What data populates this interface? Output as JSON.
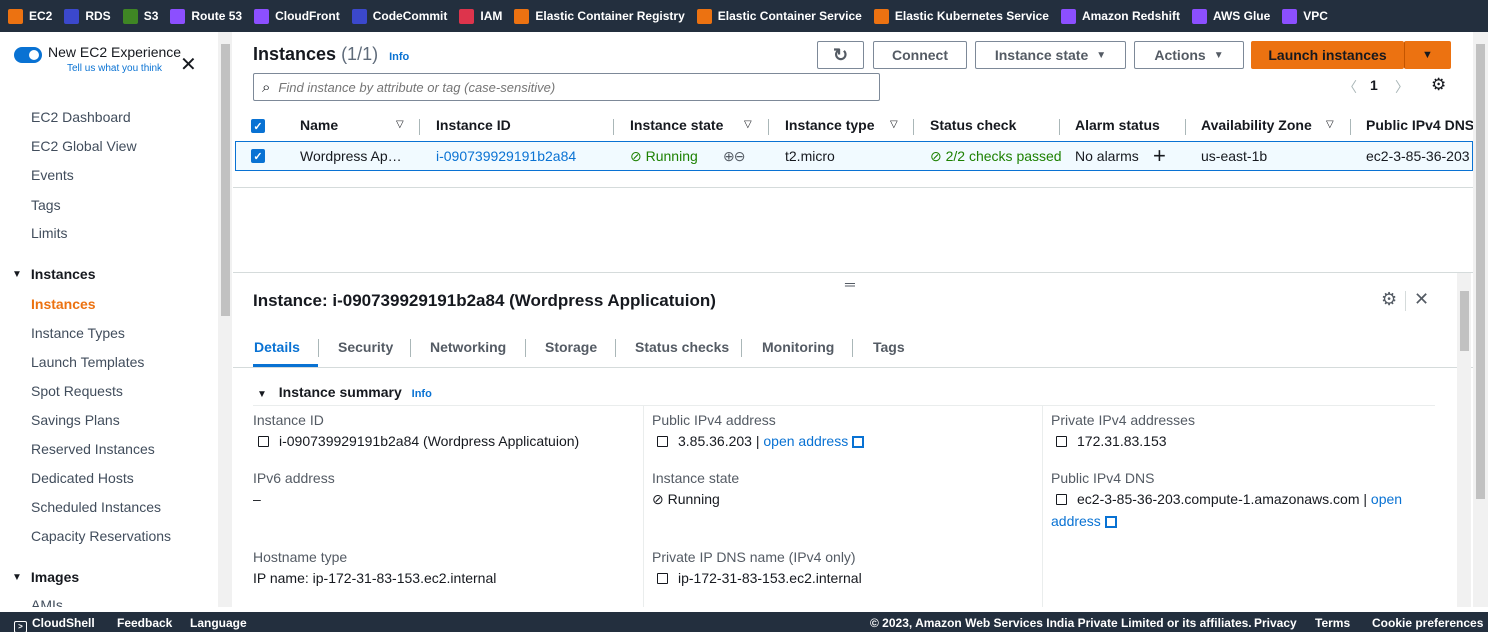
{
  "topbar": {
    "services": [
      {
        "label": "EC2",
        "color": "#ec7211"
      },
      {
        "label": "RDS",
        "color": "#3b48cc"
      },
      {
        "label": "S3",
        "color": "#3f8624"
      },
      {
        "label": "Route 53",
        "color": "#8c4fff"
      },
      {
        "label": "CloudFront",
        "color": "#8c4fff"
      },
      {
        "label": "CodeCommit",
        "color": "#3b48cc"
      },
      {
        "label": "IAM",
        "color": "#dd344c"
      },
      {
        "label": "Elastic Container Registry",
        "color": "#ec7211"
      },
      {
        "label": "Elastic Container Service",
        "color": "#ec7211"
      },
      {
        "label": "Elastic Kubernetes Service",
        "color": "#ec7211"
      },
      {
        "label": "Amazon Redshift",
        "color": "#8c4fff"
      },
      {
        "label": "AWS Glue",
        "color": "#8c4fff"
      },
      {
        "label": "VPC",
        "color": "#8c4fff"
      }
    ]
  },
  "sidebar": {
    "toggle_title": "New EC2 Experience",
    "toggle_link": "Tell us what you think",
    "items": [
      "EC2 Dashboard",
      "EC2 Global View",
      "Events",
      "Tags",
      "Limits"
    ],
    "section_instances": "Instances",
    "instances_items": [
      "Instances",
      "Instance Types",
      "Launch Templates",
      "Spot Requests",
      "Savings Plans",
      "Reserved Instances",
      "Dedicated Hosts",
      "Scheduled Instances",
      "Capacity Reservations"
    ],
    "section_images": "Images",
    "images_items": [
      "AMIs"
    ]
  },
  "header": {
    "title": "Instances",
    "count": "(1/1)",
    "info": "Info",
    "connect": "Connect",
    "instance_state": "Instance state",
    "actions": "Actions",
    "launch": "Launch instances"
  },
  "search": {
    "placeholder": "Find instance by attribute or tag (case-sensitive)"
  },
  "pager": {
    "page": "1"
  },
  "table": {
    "headers": [
      "Name",
      "Instance ID",
      "Instance state",
      "Instance type",
      "Status check",
      "Alarm status",
      "Availability Zone",
      "Public IPv4 DNS"
    ],
    "row": {
      "name": "Wordpress Ap…",
      "id": "i-090739929191b2a84",
      "state": "Running",
      "type": "t2.micro",
      "status": "2/2 checks passed",
      "alarm": "No alarms",
      "az": "us-east-1b",
      "dns": "ec2-3-85-36-203"
    }
  },
  "details": {
    "title": "Instance: i-090739929191b2a84 (Wordpress Applicatuion)",
    "tabs": [
      "Details",
      "Security",
      "Networking",
      "Storage",
      "Status checks",
      "Monitoring",
      "Tags"
    ],
    "summary": "Instance summary",
    "info": "Info",
    "instance_id_label": "Instance ID",
    "instance_id_value": "i-090739929191b2a84 (Wordpress Applicatuion)",
    "public_ip_label": "Public IPv4 address",
    "public_ip_value": "3.85.36.203 |",
    "open_address": "open address",
    "private_ip_label": "Private IPv4 addresses",
    "private_ip_value": "172.31.83.153",
    "ipv6_label": "IPv6 address",
    "ipv6_value": "–",
    "state_label": "Instance state",
    "state_value": "Running",
    "public_dns_label": "Public IPv4 DNS",
    "public_dns_value": "ec2-3-85-36-203.compute-1.amazonaws.com |",
    "open_word": "open",
    "address_word": "address",
    "hostname_label": "Hostname type",
    "hostname_value": "IP name: ip-172-31-83-153.ec2.internal",
    "private_dns_label": "Private IP DNS name (IPv4 only)",
    "private_dns_value": "ip-172-31-83-153.ec2.internal"
  },
  "footer": {
    "cloudshell": "CloudShell",
    "feedback": "Feedback",
    "language": "Language",
    "copyright": "© 2023, Amazon Web Services India Private Limited or its affiliates.",
    "privacy": "Privacy",
    "terms": "Terms",
    "cookies": "Cookie preferences"
  }
}
